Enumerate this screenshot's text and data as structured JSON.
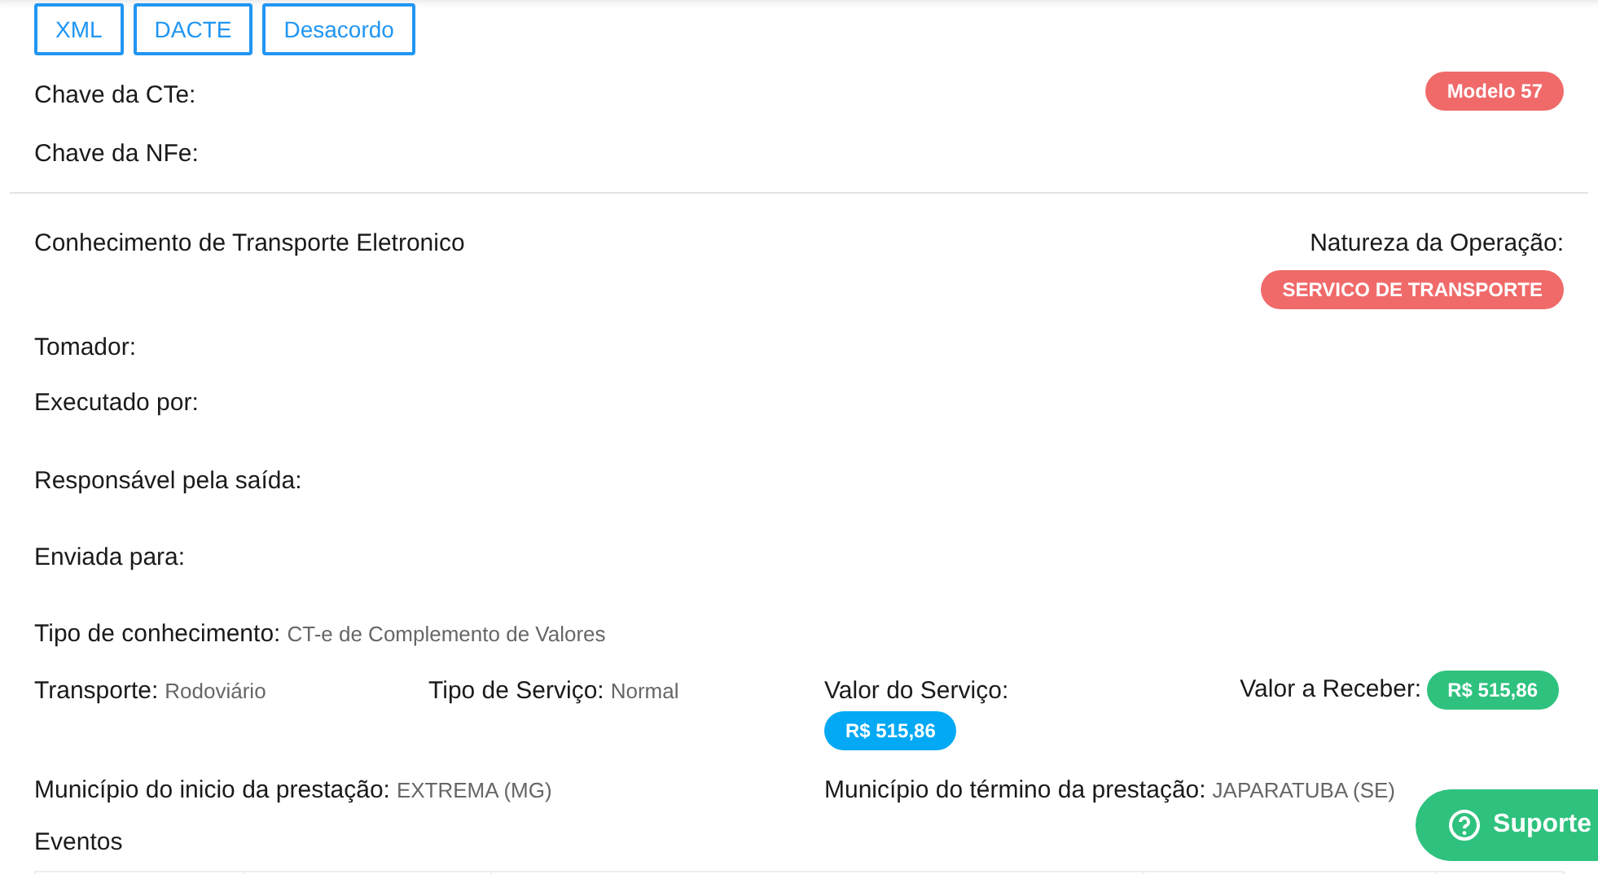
{
  "actions": [
    "XML",
    "DACTE",
    "Desacordo"
  ],
  "keys": [
    {
      "label": "Chave da CTe:"
    },
    {
      "label": "Chave da NFe:"
    }
  ],
  "model_badge": "Modelo 57",
  "document_title": "Conhecimento de Transporte Eletronico",
  "natureza": {
    "label": "Natureza da Operação:",
    "value": "SERVICO DE TRANSPORTE"
  },
  "parties": [
    {
      "label": "Tomador:"
    },
    {
      "label": "Executado por:"
    },
    {
      "label": "Responsável pela saída:"
    },
    {
      "label": "Enviada para:"
    }
  ],
  "tipo_conhecimento": {
    "label": "Tipo de conhecimento:",
    "value": "CT-e de Complemento de Valores"
  },
  "details": [
    {
      "kind": "text",
      "label": "Transporte:",
      "value": "Rodoviário"
    },
    {
      "kind": "text",
      "label": "Tipo de Serviço:",
      "value": "Normal"
    },
    {
      "kind": "badge_below",
      "label": "Valor do Serviço:",
      "value": "R$ 515,86",
      "color": "#03a9f4"
    },
    {
      "kind": "badge_inline",
      "label": "Valor a Receber:",
      "value": "R$ 515,86",
      "color": "#2ec27e"
    }
  ],
  "municipios": [
    {
      "label": "Município do inicio da prestação:",
      "value": "EXTREMA (MG)"
    },
    {
      "label": "Município do término da prestação:",
      "value": "JAPARATUBA (SE)"
    }
  ],
  "eventos_title": "Eventos",
  "support_button": "Suporte"
}
